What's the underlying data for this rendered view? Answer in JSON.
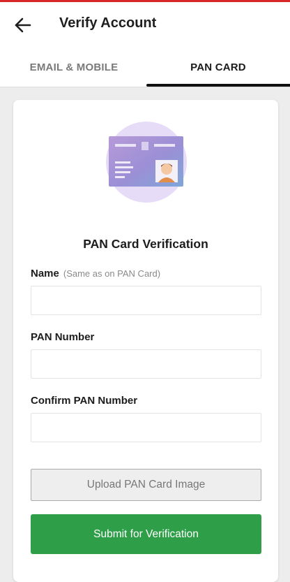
{
  "header": {
    "title": "Verify Account",
    "back_icon": "arrow-left-icon"
  },
  "tabs": [
    {
      "label": "EMAIL & MOBILE",
      "active": false
    },
    {
      "label": "PAN CARD",
      "active": true
    }
  ],
  "card": {
    "illustration_icon": "pan-card-icon",
    "title": "PAN Card Verification",
    "fields": {
      "name": {
        "label": "Name",
        "hint": "(Same as on PAN Card)",
        "value": "",
        "placeholder": ""
      },
      "pan_number": {
        "label": "PAN Number",
        "value": "",
        "placeholder": ""
      },
      "confirm_pan": {
        "label": "Confirm PAN Number",
        "value": "",
        "placeholder": ""
      }
    },
    "upload_label": "Upload PAN Card Image",
    "submit_label": "Submit for Verification"
  },
  "colors": {
    "accent_strip": "#d62828",
    "submit_green": "#2e9e48",
    "tab_active": "#111111",
    "tab_inactive": "#7a7a7a",
    "illustration_circle": "#e6dcf7"
  }
}
